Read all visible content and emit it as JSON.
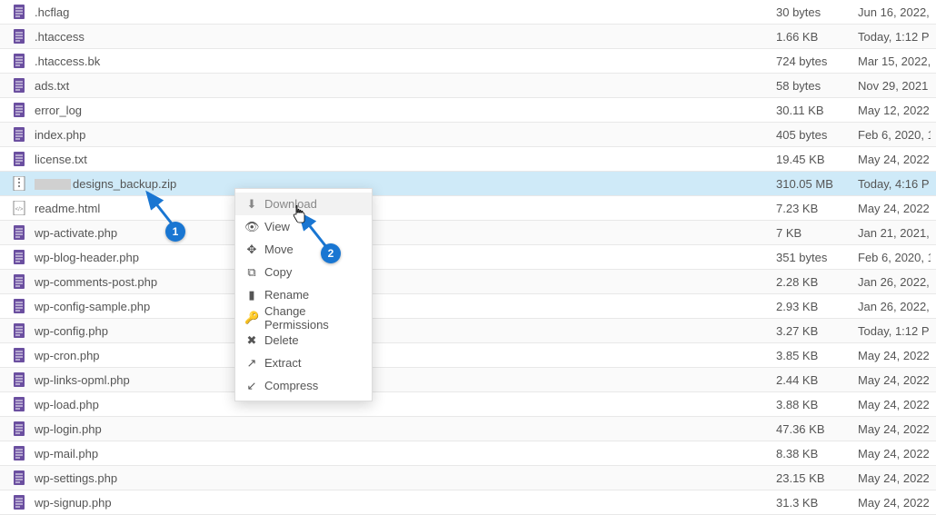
{
  "files": [
    {
      "name": ".hcflag",
      "size": "30 bytes",
      "date": "Jun 16, 2022,",
      "icon": "doc"
    },
    {
      "name": ".htaccess",
      "size": "1.66 KB",
      "date": "Today, 1:12 P",
      "icon": "doc"
    },
    {
      "name": ".htaccess.bk",
      "size": "724 bytes",
      "date": "Mar 15, 2022,",
      "icon": "doc"
    },
    {
      "name": "ads.txt",
      "size": "58 bytes",
      "date": "Nov 29, 2021",
      "icon": "doc"
    },
    {
      "name": "error_log",
      "size": "30.11 KB",
      "date": "May 12, 2022",
      "icon": "doc"
    },
    {
      "name": "index.php",
      "size": "405 bytes",
      "date": "Feb 6, 2020, 1",
      "icon": "doc"
    },
    {
      "name": "license.txt",
      "size": "19.45 KB",
      "date": "May 24, 2022",
      "icon": "doc"
    },
    {
      "name": "designs_backup.zip",
      "size": "310.05 MB",
      "date": "Today, 4:16 P",
      "icon": "zip",
      "selected": true,
      "redacted_prefix": true
    },
    {
      "name": "readme.html",
      "size": "7.23 KB",
      "date": "May 24, 2022",
      "icon": "html"
    },
    {
      "name": "wp-activate.php",
      "size": "7 KB",
      "date": "Jan 21, 2021,",
      "icon": "doc"
    },
    {
      "name": "wp-blog-header.php",
      "size": "351 bytes",
      "date": "Feb 6, 2020, 1",
      "icon": "doc"
    },
    {
      "name": "wp-comments-post.php",
      "size": "2.28 KB",
      "date": "Jan 26, 2022,",
      "icon": "doc"
    },
    {
      "name": "wp-config-sample.php",
      "size": "2.93 KB",
      "date": "Jan 26, 2022,",
      "icon": "doc"
    },
    {
      "name": "wp-config.php",
      "size": "3.27 KB",
      "date": "Today, 1:12 P",
      "icon": "doc"
    },
    {
      "name": "wp-cron.php",
      "size": "3.85 KB",
      "date": "May 24, 2022",
      "icon": "doc"
    },
    {
      "name": "wp-links-opml.php",
      "size": "2.44 KB",
      "date": "May 24, 2022",
      "icon": "doc"
    },
    {
      "name": "wp-load.php",
      "size": "3.88 KB",
      "date": "May 24, 2022",
      "icon": "doc"
    },
    {
      "name": "wp-login.php",
      "size": "47.36 KB",
      "date": "May 24, 2022",
      "icon": "doc"
    },
    {
      "name": "wp-mail.php",
      "size": "8.38 KB",
      "date": "May 24, 2022",
      "icon": "doc"
    },
    {
      "name": "wp-settings.php",
      "size": "23.15 KB",
      "date": "May 24, 2022",
      "icon": "doc"
    },
    {
      "name": "wp-signup.php",
      "size": "31.3 KB",
      "date": "May 24, 2022",
      "icon": "doc"
    }
  ],
  "context_menu": {
    "items": [
      {
        "icon": "download-icon",
        "glyph": "⬇",
        "label": "Download",
        "hover": true
      },
      {
        "icon": "view-icon",
        "glyph": "👁",
        "label": "View"
      },
      {
        "icon": "move-icon",
        "glyph": "✥",
        "label": "Move"
      },
      {
        "icon": "copy-icon",
        "glyph": "⧉",
        "label": "Copy"
      },
      {
        "icon": "rename-icon",
        "glyph": "▮",
        "label": "Rename"
      },
      {
        "icon": "permissions-icon",
        "glyph": "🔑",
        "label": "Change Permissions"
      },
      {
        "icon": "delete-icon",
        "glyph": "✖",
        "label": "Delete"
      },
      {
        "icon": "extract-icon",
        "glyph": "↗",
        "label": "Extract"
      },
      {
        "icon": "compress-icon",
        "glyph": "↙",
        "label": "Compress"
      }
    ]
  },
  "callouts": {
    "one": "1",
    "two": "2"
  }
}
